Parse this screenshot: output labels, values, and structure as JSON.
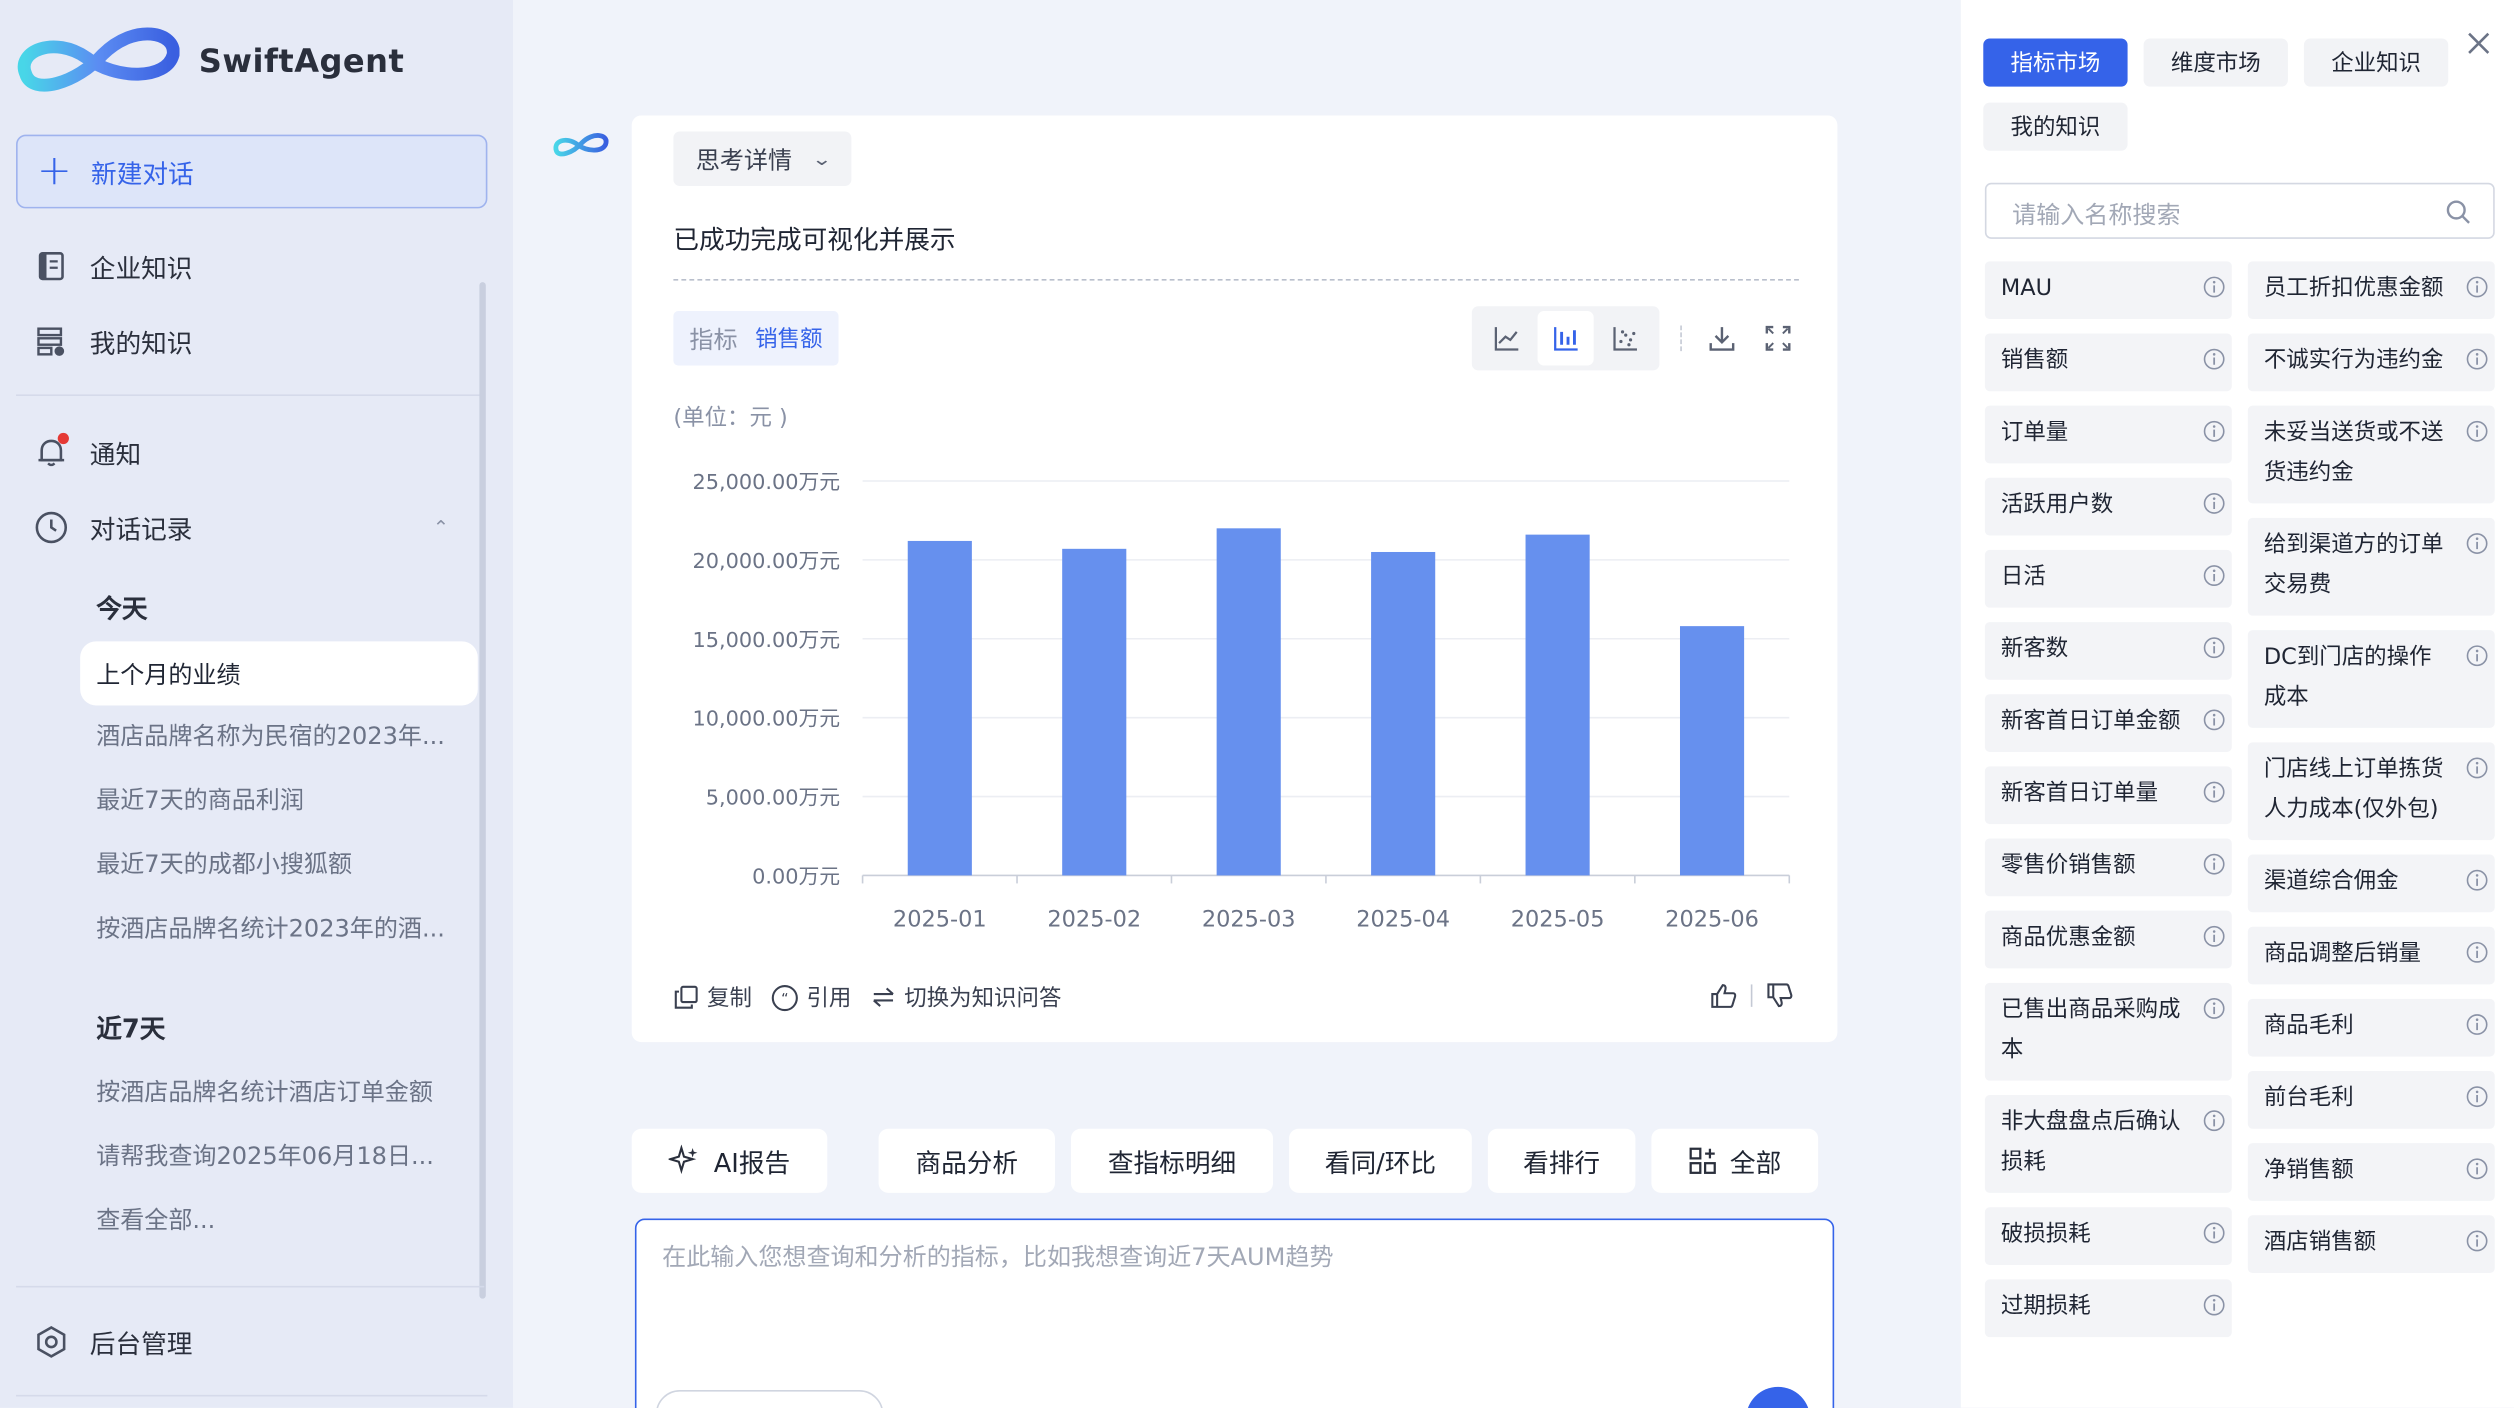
{
  "sidebar": {
    "brand": "SwiftAgent",
    "new_chat": "新建对话",
    "nav": {
      "enterprise_knowledge": "企业知识",
      "my_knowledge": "我的知识",
      "notifications": "通知",
      "chat_history": "对话记录"
    },
    "today_label": "今天",
    "today_items": [
      "上个月的业绩",
      "酒店品牌名称为民宿的2023年...",
      "最近7天的商品利润",
      "最近7天的成都小搜狐额",
      "按酒店品牌名统计2023年的酒..."
    ],
    "week_label": "近7天",
    "week_items": [
      "按酒店品牌名统计酒店订单金额",
      "请帮我查询2025年06月18日...",
      "查看全部..."
    ],
    "admin": "后台管理"
  },
  "message": {
    "think_label": "思考详情",
    "status_text": "已成功完成可视化并展示",
    "metric_key": "指标",
    "metric_value": "销售额",
    "unit_label": "(单位：元 )",
    "actions": {
      "copy": "复制",
      "cite": "引用",
      "switch": "切换为知识问答"
    }
  },
  "chart_data": {
    "type": "bar",
    "categories": [
      "2025-01",
      "2025-02",
      "2025-03",
      "2025-04",
      "2025-05",
      "2025-06"
    ],
    "series": [
      {
        "values": [
          21200,
          20700,
          22000,
          20500,
          21600,
          15800
        ]
      }
    ],
    "y_ticks": [
      "0.00万元",
      "5,000.00万元",
      "10,000.00万元",
      "15,000.00万元",
      "20,000.00万元",
      "25,000.00万元"
    ],
    "ylim": [
      0,
      25000
    ],
    "ylabel": "(单位：元 )",
    "grid": true,
    "color": "#6690ee"
  },
  "quick_actions": {
    "ai_report": "AI报告",
    "goods_analysis": "商品分析",
    "metric_detail": "查指标明细",
    "yoy_mom": "看同/环比",
    "ranking": "看排行",
    "all": "全部"
  },
  "input": {
    "placeholder": "在此输入您想查询和分析的指标，比如我想查询近7天AUM趋势"
  },
  "panel": {
    "tabs": [
      "指标市场",
      "维度市场",
      "企业知识",
      "我的知识"
    ],
    "search_placeholder": "请输入名称搜索",
    "left_metrics": [
      "MAU",
      "销售额",
      "订单量",
      "活跃用户数",
      "日活",
      "新客数",
      "新客首日订单金额",
      "新客首日订单量",
      "零售价销售额",
      "商品优惠金额",
      "已售出商品采购成本",
      "非大盘盘点后确认损耗",
      "破损损耗",
      "过期损耗"
    ],
    "right_metrics": [
      "员工折扣优惠金额",
      "不诚实行为违约金",
      "未妥当送货或不送货违约金",
      "给到渠道方的订单交易费",
      "DC到门店的操作成本",
      "门店线上订单拣货人力成本(仅外包)",
      "渠道综合佣金",
      "商品调整后销量",
      "商品毛利",
      "前台毛利",
      "净销售额",
      "酒店销售额"
    ]
  },
  "colors": {
    "accent": "#3563e9",
    "bar": "#6690ee",
    "sidebar_bg": "#e6eaf6",
    "main_bg": "#f0f3fa"
  }
}
